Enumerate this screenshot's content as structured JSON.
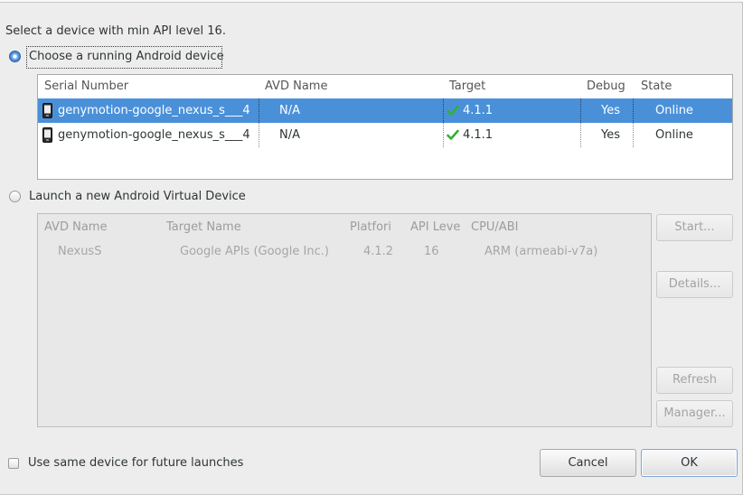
{
  "dialog": {
    "instruction": "Select a device with min API level 16."
  },
  "running": {
    "radio_label": "Choose a running Android device",
    "selected": true,
    "columns": [
      "Serial Number",
      "AVD Name",
      "Target",
      "Debug",
      "State"
    ],
    "rows": [
      {
        "icon": "phone-icon",
        "serial": "genymotion-google_nexus_s___4",
        "avd_name": "N/A",
        "target_icon": "check-icon",
        "target": "4.1.1",
        "debug": "Yes",
        "state": "Online",
        "selected": true
      },
      {
        "icon": "phone-icon",
        "serial": "genymotion-google_nexus_s___4",
        "avd_name": "N/A",
        "target_icon": "check-icon",
        "target": "4.1.1",
        "debug": "Yes",
        "state": "Online",
        "selected": false
      }
    ]
  },
  "launch": {
    "radio_label": "Launch a new Android Virtual Device",
    "selected": false,
    "enabled": false,
    "columns": [
      "AVD Name",
      "Target Name",
      "Platfori",
      "API Leve",
      "CPU/ABI"
    ],
    "rows": [
      {
        "avd_name": "NexusS",
        "target_name": "Google APIs (Google Inc.)",
        "platform": "4.1.2",
        "api_level": "16",
        "cpu_abi": "ARM (armeabi-v7a)"
      }
    ],
    "buttons": {
      "start": "Start...",
      "details": "Details...",
      "refresh": "Refresh",
      "manager": "Manager..."
    }
  },
  "footer": {
    "same_device_label": "Use same device for future launches",
    "same_device_checked": false,
    "cancel": "Cancel",
    "ok": "OK"
  },
  "colors": {
    "selection": "#4a90d9",
    "selection_text": "#ffffff",
    "check": "#34b034",
    "default_button_border": "#7fa3d3"
  }
}
